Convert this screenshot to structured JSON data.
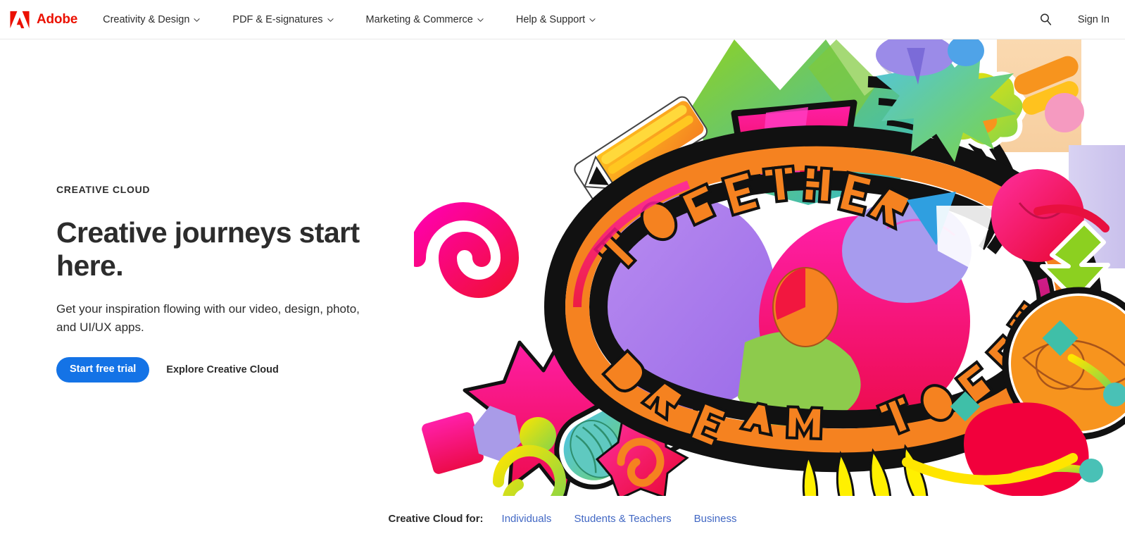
{
  "brand": {
    "name": "Adobe",
    "logo_icon": "adobe-a-logo",
    "logo_color": "#EB1000"
  },
  "nav": {
    "items": [
      {
        "label": "Creativity & Design",
        "caret_icon": "chevron-down-icon"
      },
      {
        "label": "PDF & E-signatures",
        "caret_icon": "chevron-down-icon"
      },
      {
        "label": "Marketing & Commerce",
        "caret_icon": "chevron-down-icon"
      },
      {
        "label": "Help & Support",
        "caret_icon": "chevron-down-icon"
      }
    ],
    "search_icon": "search-icon",
    "sign_in": "Sign In"
  },
  "hero": {
    "eyebrow": "CREATIVE CLOUD",
    "headline": "Creative journeys start here.",
    "subhead": "Get your inspiration flowing with our video, design, photo, and UI/UX apps.",
    "primary_cta": "Start free trial",
    "secondary_cta": "Explore Creative Cloud",
    "primary_cta_color": "#1473E6",
    "artwork": {
      "alt": "Colorful abstract illustration with the words DREAM TOGETHER",
      "words": [
        "DREAM",
        "TOGETHER"
      ]
    }
  },
  "audience": {
    "label": "Creative Cloud for:",
    "links": [
      "Individuals",
      "Students & Teachers",
      "Business"
    ],
    "link_color": "#4268C4"
  }
}
